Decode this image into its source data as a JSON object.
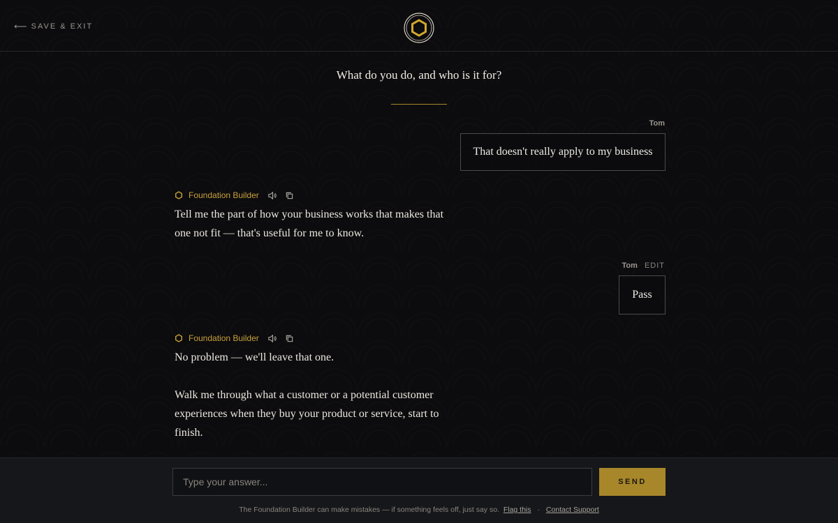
{
  "header": {
    "save_exit_label": "SAVE & EXIT",
    "back_icon": "arrow-left-icon",
    "logo_icon": "hexagon-logo-icon"
  },
  "question": "What do you do, and who is it for?",
  "messages": [
    {
      "role": "user",
      "author": "Tom",
      "text": "That doesn't really apply to my business"
    },
    {
      "role": "assistant",
      "author": "Foundation Builder",
      "paragraphs": [
        "Tell me the part of how your business works that makes that one not fit — that's useful for me to know."
      ]
    },
    {
      "role": "user",
      "author": "Tom",
      "edit_label": "EDIT",
      "text": "Pass"
    },
    {
      "role": "assistant",
      "author": "Foundation Builder",
      "paragraphs": [
        "No problem — we'll leave that one.",
        "Walk me through what a customer or a potential customer experiences when they buy your product or service, start to finish."
      ]
    }
  ],
  "composer": {
    "placeholder": "Type your answer...",
    "value": "",
    "send_label": "SEND"
  },
  "footer": {
    "disclaimer": "The Foundation Builder can make mistakes — if something feels off, just say so.",
    "flag_label": "Flag this",
    "separator": "·",
    "support_label": "Contact Support"
  },
  "colors": {
    "accent": "#c9a13a",
    "send_bg": "#a8872a",
    "background": "#0c0c0e"
  }
}
